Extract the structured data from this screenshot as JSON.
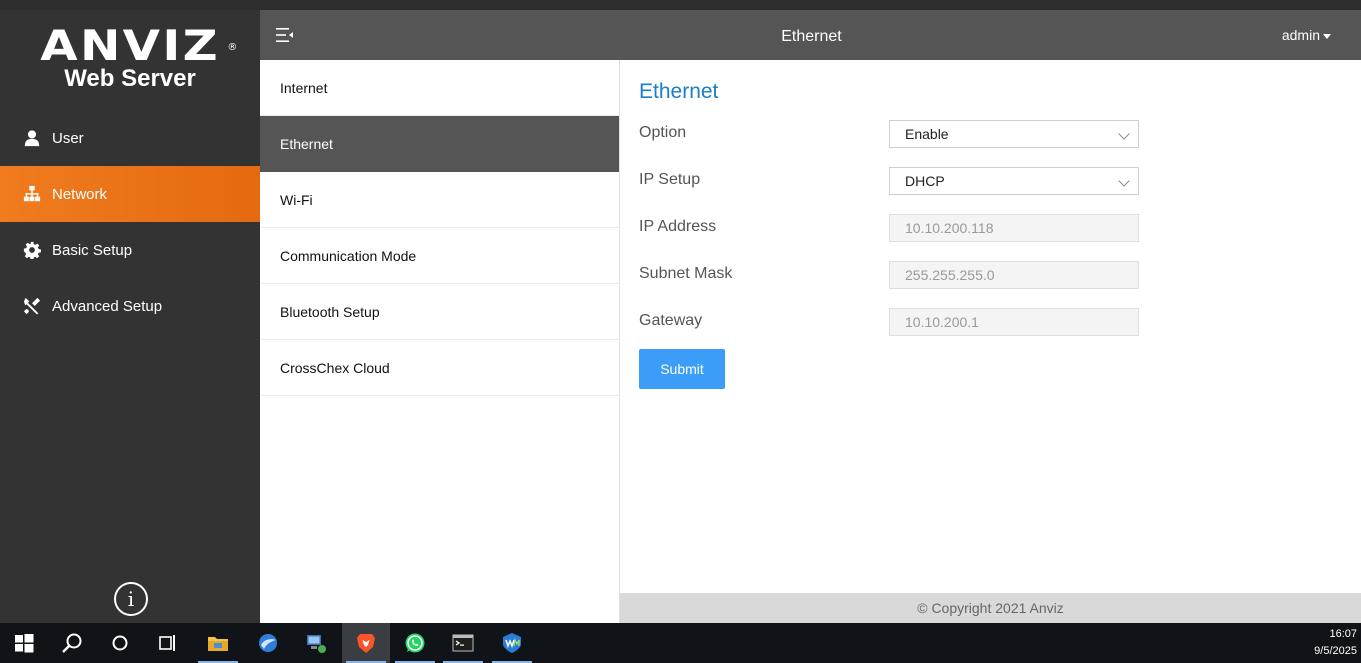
{
  "brand": {
    "logo": "ANVIZ",
    "registered": "®",
    "subtitle": "Web Server"
  },
  "sidebar": {
    "items": [
      {
        "label": "User",
        "icon": "user-icon",
        "active": false
      },
      {
        "label": "Network",
        "icon": "network-icon",
        "active": true
      },
      {
        "label": "Basic Setup",
        "icon": "gear-icon",
        "active": false
      },
      {
        "label": "Advanced Setup",
        "icon": "tools-icon",
        "active": false
      }
    ],
    "info_icon": "info-icon",
    "info_glyph": "i"
  },
  "header": {
    "title": "Ethernet",
    "user": "admin"
  },
  "submenu": {
    "items": [
      {
        "label": "Internet",
        "active": false
      },
      {
        "label": "Ethernet",
        "active": true
      },
      {
        "label": "Wi-Fi",
        "active": false
      },
      {
        "label": "Communication Mode",
        "active": false
      },
      {
        "label": "Bluetooth Setup",
        "active": false
      },
      {
        "label": "CrossChex Cloud",
        "active": false
      }
    ]
  },
  "content": {
    "title": "Ethernet",
    "fields": [
      {
        "label": "Option",
        "value": "Enable",
        "type": "select",
        "disabled": false
      },
      {
        "label": "IP Setup",
        "value": "DHCP",
        "type": "select",
        "disabled": false
      },
      {
        "label": "IP Address",
        "value": "10.10.200.118",
        "type": "input",
        "disabled": true
      },
      {
        "label": "Subnet Mask",
        "value": "255.255.255.0",
        "type": "input",
        "disabled": true
      },
      {
        "label": "Gateway",
        "value": "10.10.200.1",
        "type": "input",
        "disabled": true
      }
    ],
    "submit_label": "Submit"
  },
  "footer": {
    "copyright": "© Copyright 2021 Anviz"
  },
  "taskbar": {
    "apps": [
      "windows-start-icon",
      "search-icon",
      "cortana-icon",
      "task-view-icon",
      "file-explorer-icon",
      "browser-icon",
      "network-tool-icon",
      "brave-icon",
      "whatsapp-icon",
      "terminal-icon",
      "app-icon"
    ],
    "time": "16:07",
    "date": "9/5/2025"
  },
  "colors": {
    "accent_orange": "#f07c1f",
    "link_blue": "#1a7fc4",
    "button_blue": "#3b9df8"
  }
}
